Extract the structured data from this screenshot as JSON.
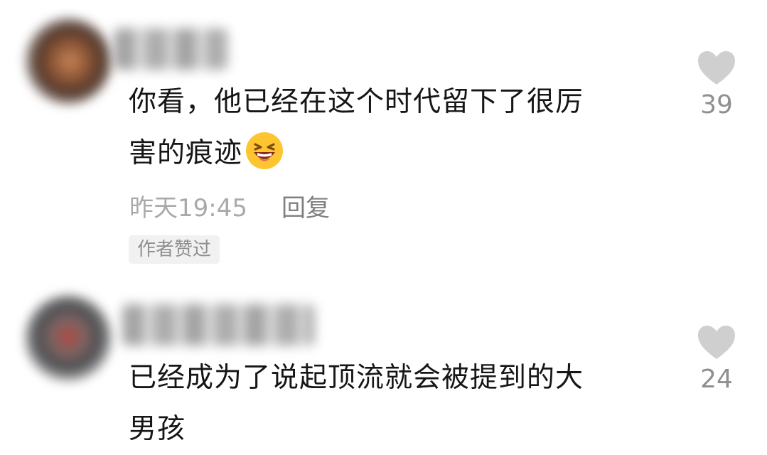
{
  "comments": [
    {
      "text_line1": "你看，他已经在这个时代留下了很厉",
      "text_line2": "害的痕迹",
      "emoji": "laughing-face-icon",
      "timestamp": "昨天19:45",
      "reply_label": "回复",
      "badge": "作者赞过",
      "like_count": "39"
    },
    {
      "text_line1": "已经成为了说起顶流就会被提到的大",
      "text_line2": "男孩",
      "like_count": "24"
    }
  ],
  "icons": {
    "like": "heart-icon"
  },
  "colors": {
    "heart": "#cfcfcf",
    "meta_text": "#a9a9a9",
    "main_text": "#161616"
  }
}
